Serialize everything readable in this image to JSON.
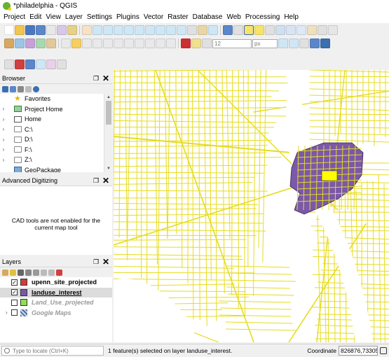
{
  "window": {
    "title": "*philadelphia - QGIS"
  },
  "menu": [
    "Project",
    "Edit",
    "View",
    "Layer",
    "Settings",
    "Plugins",
    "Vector",
    "Raster",
    "Database",
    "Web",
    "Processing",
    "Help"
  ],
  "toolbar": {
    "font_size_value": "12",
    "unit_value": "px"
  },
  "browser": {
    "title": "Browser",
    "items": [
      {
        "label": "Favorites",
        "icon": "star-icon",
        "expandable": false
      },
      {
        "label": "Project Home",
        "icon": "project-home-icon",
        "expandable": true
      },
      {
        "label": "Home",
        "icon": "home-icon",
        "expandable": true
      },
      {
        "label": "C:\\",
        "icon": "drive-icon",
        "expandable": true
      },
      {
        "label": "D:\\",
        "icon": "drive-icon",
        "expandable": true
      },
      {
        "label": "F:\\",
        "icon": "drive-icon",
        "expandable": true
      },
      {
        "label": "Z:\\",
        "icon": "drive-icon",
        "expandable": true
      },
      {
        "label": "GeoPackage",
        "icon": "geopackage-icon",
        "expandable": false
      }
    ]
  },
  "advanced_digitizing": {
    "title": "Advanced Digitizing",
    "message": "CAD tools are not enabled for the current map tool"
  },
  "layers": {
    "title": "Layers",
    "items": [
      {
        "name": "upenn_site_projected",
        "checked": true,
        "color": "#d83a3a",
        "selected": false,
        "dim": false
      },
      {
        "name": "landuse_interest",
        "checked": true,
        "color": "#7b58a8",
        "selected": true,
        "dim": false
      },
      {
        "name": "Land_Use_projected",
        "checked": false,
        "color": "#8fe04a",
        "selected": false,
        "dim": true
      },
      {
        "name": "Google Maps",
        "checked": false,
        "color": "#4a6fa5",
        "selected": false,
        "dim": true
      }
    ]
  },
  "status": {
    "locator_placeholder": "Type to locate (Ctrl+K)",
    "message": "1 feature(s) selected on layer landuse_interest.",
    "coordinate_label": "Coordinate",
    "coordinate_value": "826876,73305"
  },
  "colors": {
    "street": "#e6dc1e",
    "street_outline": "#333333",
    "landuse": "#7b58a8",
    "selected": "#ffff00"
  }
}
